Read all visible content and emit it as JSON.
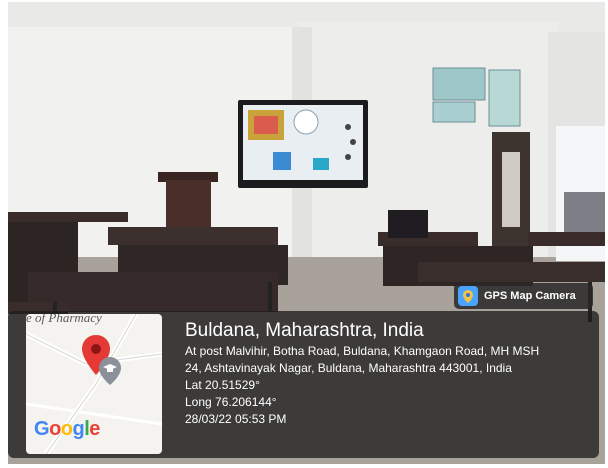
{
  "badge": {
    "label": "GPS Map Camera",
    "icon": "camera-pin-icon"
  },
  "map": {
    "place_label": "e of Pharmacy",
    "logo_letters": [
      "G",
      "o",
      "o",
      "g",
      "l",
      "e"
    ],
    "logo_colors": [
      "#4285F4",
      "#EA4335",
      "#FBBC05",
      "#4285F4",
      "#34A853",
      "#EA4335"
    ],
    "pin_color": "#E53935"
  },
  "location": {
    "title": "Buldana, Maharashtra, India",
    "address_line1": "At post Malvihir, Botha Road, Buldana, Khamgaon Road, MH MSH",
    "address_line2": "24, Ashtavinayak Nagar, Buldana, Maharashtra 443001, India",
    "lat": "Lat 20.51529°",
    "long": "Long 76.206144°",
    "datetime": "28/03/22 05:53 PM"
  }
}
